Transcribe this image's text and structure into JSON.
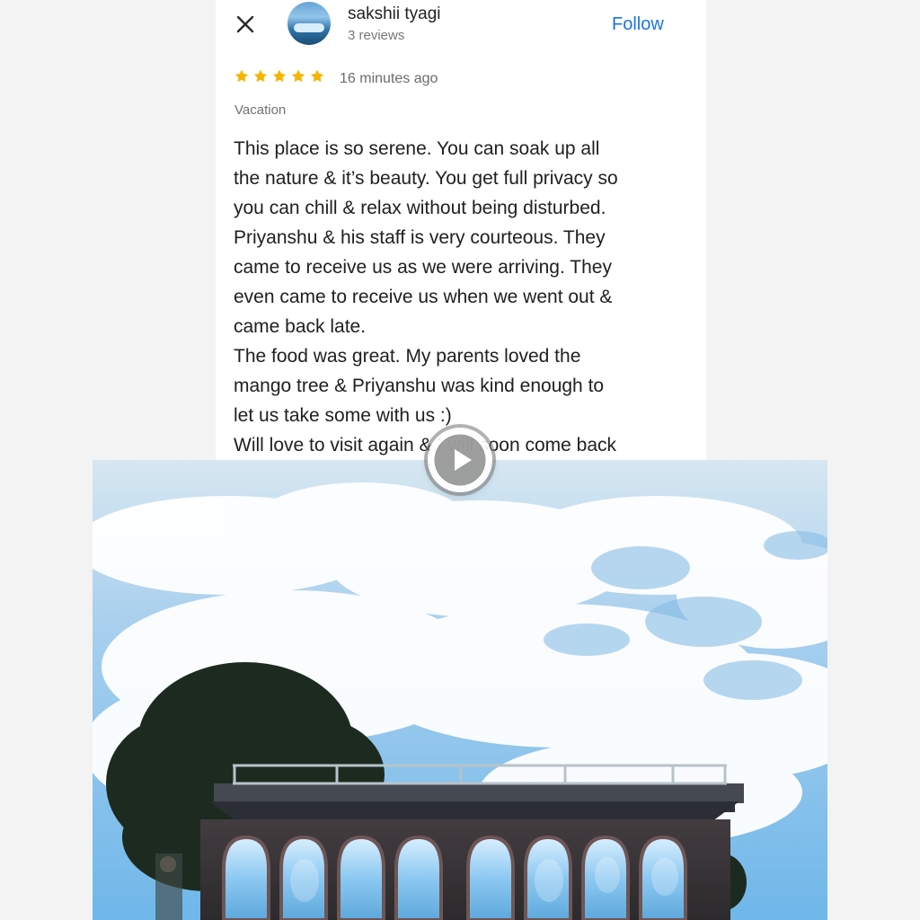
{
  "review": {
    "reviewer_name": "sakshii tyagi",
    "reviewer_meta": "3 reviews",
    "follow_label": "Follow",
    "rating": 5,
    "time_ago": "16 minutes ago",
    "trip_type": "Vacation",
    "text": "This place is so serene. You can soak up all\nthe nature & it’s beauty. You get full privacy so\nyou can chill & relax without being disturbed.\nPriyanshu & his staff is very courteous. They\ncame to receive us as we were arriving. They\neven came to receive us when we went out &\ncame back late.\nThe food was great. My parents loved the\nmango tree & Priyanshu was kind enough to\nlet us take some with us :)\nWill love to visit again & I will soon come back"
  },
  "icons": {
    "close": "close-icon",
    "avatar": "avatar-image",
    "star": "star-icon",
    "play": "play-icon"
  },
  "colors": {
    "accent": "#1a73e8",
    "star": "#f4b400",
    "text": "#202020",
    "secondary_text": "#777777",
    "sky": "#8fc2ea"
  }
}
